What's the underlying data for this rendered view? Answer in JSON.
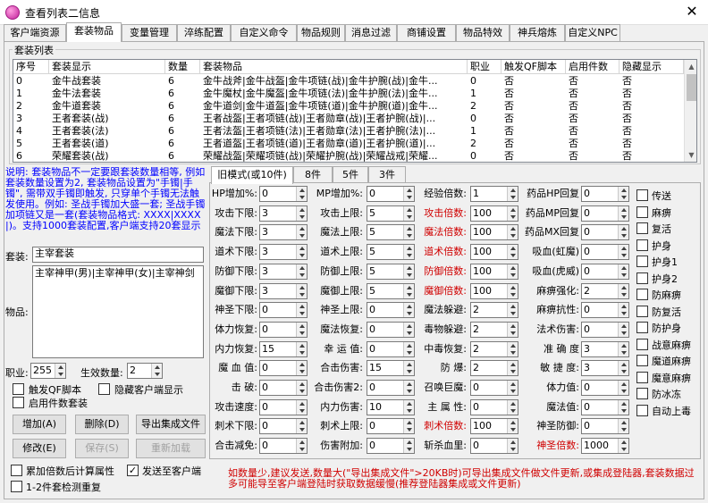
{
  "window": {
    "title": "查看列表二信息",
    "close": "✕"
  },
  "tabs": [
    "客户端资源",
    "套装物品",
    "变量管理",
    "淬练配置",
    "自定义命令",
    "物品规则",
    "消息过滤",
    "商铺设置",
    "物品特效",
    "神兵熔炼",
    "自定义NPC"
  ],
  "group_title": "套装列表",
  "table": {
    "headers": [
      "序号",
      "套装显示",
      "数量",
      "套装物品",
      "职业",
      "触发QF脚本",
      "启用件数",
      "隐藏显示"
    ],
    "rows": [
      [
        "0",
        "金牛战套装",
        "6",
        "金牛战斧|金牛战盔|金牛项链(战)|金牛护腕(战)|金牛...",
        "0",
        "否",
        "否",
        "否"
      ],
      [
        "1",
        "金牛法套装",
        "6",
        "金牛魔杖|金牛魔盔|金牛项链(法)|金牛护腕(法)|金牛...",
        "1",
        "否",
        "否",
        "否"
      ],
      [
        "2",
        "金牛道套装",
        "6",
        "金牛道剑|金牛道盔|金牛项链(道)|金牛护腕(道)|金牛...",
        "2",
        "否",
        "否",
        "否"
      ],
      [
        "3",
        "王者套装(战)",
        "6",
        "王者战盔|王者项链(战)|王者勋章(战)|王者护腕(战)|...",
        "0",
        "否",
        "否",
        "否"
      ],
      [
        "4",
        "王者套装(法)",
        "6",
        "王者法盔|王者项链(法)|王者勋章(法)|王者护腕(法)|...",
        "1",
        "否",
        "否",
        "否"
      ],
      [
        "5",
        "王者套装(道)",
        "6",
        "王者道盔|王者项链(道)|王者勋章(道)|王者护腕(道)|...",
        "2",
        "否",
        "否",
        "否"
      ],
      [
        "6",
        "荣耀套装(战)",
        "6",
        "荣耀战盔|荣耀项链(战)|荣耀护腕(战)|荣耀战戒|荣耀...",
        "0",
        "否",
        "否",
        "否"
      ]
    ]
  },
  "info_text": "说明: 套装物品不一定要跟套装数量相等, 例如套装数量设置为2, 套装物品设置为\"手镯|手镯\", 需带双手镯即触发, 只穿单个手镯无法触发使用。例如: 圣战手镯加大盛一套; 圣战手镯加项链又是一套(套装物品格式: XXXX|XXXX|)。支持1000套装配置,客户端支持20套显示",
  "form": {
    "suit_label": "套装:",
    "suit_value": "主宰套装",
    "items_label": "物品:",
    "items_value": "主宰神甲(男)|主宰神甲(女)|主宰神剑",
    "job_label": "职业:",
    "job_value": "255",
    "count_label": "生效数量:",
    "count_value": "2"
  },
  "checks_left": [
    {
      "label": "触发QF脚本",
      "checked": false
    },
    {
      "label": "隐藏客户端显示",
      "checked": false
    },
    {
      "label": "启用件数套装",
      "checked": false
    }
  ],
  "buttons": {
    "add": "增加(A)",
    "del": "删除(D)",
    "export": "导出集成文件",
    "edit": "修改(E)",
    "save": "保存(S)",
    "reload": "重新加载"
  },
  "bottom_checks": [
    {
      "label": "累加倍数后计算属性",
      "checked": false
    },
    {
      "label": "发送至客户端",
      "checked": true
    },
    {
      "label": "1-2件套检测重复",
      "checked": false
    }
  ],
  "subtabs": [
    "旧模式(或10件)",
    "8件",
    "5件",
    "3件"
  ],
  "fields": [
    [
      {
        "label": "HP增加%:",
        "value": "0"
      },
      {
        "label": "MP增加%:",
        "value": "0"
      },
      {
        "label": "经验倍数:",
        "value": "1"
      },
      {
        "label": "药品HP回复",
        "value": "0"
      }
    ],
    [
      {
        "label": "攻击下限:",
        "value": "3"
      },
      {
        "label": "攻击上限:",
        "value": "5"
      },
      {
        "label": "攻击倍数:",
        "value": "100",
        "red": true
      },
      {
        "label": "药品MP回复",
        "value": "0"
      }
    ],
    [
      {
        "label": "魔法下限:",
        "value": "3"
      },
      {
        "label": "魔法上限:",
        "value": "5"
      },
      {
        "label": "魔法倍数:",
        "value": "100",
        "red": true
      },
      {
        "label": "药品MX回复",
        "value": "0"
      }
    ],
    [
      {
        "label": "道术下限:",
        "value": "3"
      },
      {
        "label": "道术上限:",
        "value": "5"
      },
      {
        "label": "道术倍数:",
        "value": "100",
        "red": true
      },
      {
        "label": "吸血(虹魔)",
        "value": "0"
      }
    ],
    [
      {
        "label": "防御下限:",
        "value": "3"
      },
      {
        "label": "防御上限:",
        "value": "5"
      },
      {
        "label": "防御倍数:",
        "value": "100",
        "red": true
      },
      {
        "label": "吸血(虎威)",
        "value": "0"
      }
    ],
    [
      {
        "label": "魔御下限:",
        "value": "3"
      },
      {
        "label": "魔御上限:",
        "value": "5"
      },
      {
        "label": "魔御倍数:",
        "value": "100",
        "red": true
      },
      {
        "label": "麻痹强化:",
        "value": "2"
      }
    ],
    [
      {
        "label": "神圣下限:",
        "value": "0"
      },
      {
        "label": "神圣上限:",
        "value": "0"
      },
      {
        "label": "魔法躲避:",
        "value": "2"
      },
      {
        "label": "麻痹抗性:",
        "value": "0"
      }
    ],
    [
      {
        "label": "体力恢复:",
        "value": "0"
      },
      {
        "label": "魔法恢复:",
        "value": "0"
      },
      {
        "label": "毒物躲避:",
        "value": "2"
      },
      {
        "label": "法术伤害:",
        "value": "0"
      }
    ],
    [
      {
        "label": "内力恢复:",
        "value": "15"
      },
      {
        "label": "幸 运 值:",
        "value": "0"
      },
      {
        "label": "中毒恢复:",
        "value": "2"
      },
      {
        "label": "准 确 度",
        "value": "3"
      }
    ],
    [
      {
        "label": "魔 血 值:",
        "value": "0"
      },
      {
        "label": "合击伤害:",
        "value": "15"
      },
      {
        "label": "防    爆:",
        "value": "2"
      },
      {
        "label": "敏 捷 度:",
        "value": "3"
      }
    ],
    [
      {
        "label": "击      破:",
        "value": "0"
      },
      {
        "label": "合击伤害2:",
        "value": "0"
      },
      {
        "label": "召唤巨魔:",
        "value": "0"
      },
      {
        "label": "体力值:",
        "value": "0"
      }
    ],
    [
      {
        "label": "攻击速度:",
        "value": "0"
      },
      {
        "label": "内力伤害:",
        "value": "10"
      },
      {
        "label": "主 属 性:",
        "value": "0"
      },
      {
        "label": "魔法值:",
        "value": "0"
      }
    ],
    [
      {
        "label": "刺术下限:",
        "value": "0"
      },
      {
        "label": "刺术上限:",
        "value": "0"
      },
      {
        "label": "刺术倍数:",
        "value": "100",
        "red": true
      },
      {
        "label": "神圣防御:",
        "value": "0"
      }
    ],
    [
      {
        "label": "合击减免:",
        "value": "0"
      },
      {
        "label": "伤害附加:",
        "value": "0"
      },
      {
        "label": "斩杀血里:",
        "value": "0"
      },
      {
        "label": "神圣倍数:",
        "value": "1000",
        "red": true
      }
    ]
  ],
  "right_checks": [
    "传送",
    "麻痹",
    "复活",
    "护身",
    "护身1",
    "护身2",
    "防麻痹",
    "防复活",
    "防护身",
    "战意麻痹",
    "魔道麻痹",
    "魔意麻痹",
    "防冰冻",
    "自动上毒"
  ],
  "bottom_note": "如数量少,建议发送,数量大(\"导出集成文件\">20KB时)可导出集成文件做文件更新,或集成登陆器,套装数据过多可能导至客户端登陆时获取数据缓慢(推荐登陆器集成或文件更新)"
}
